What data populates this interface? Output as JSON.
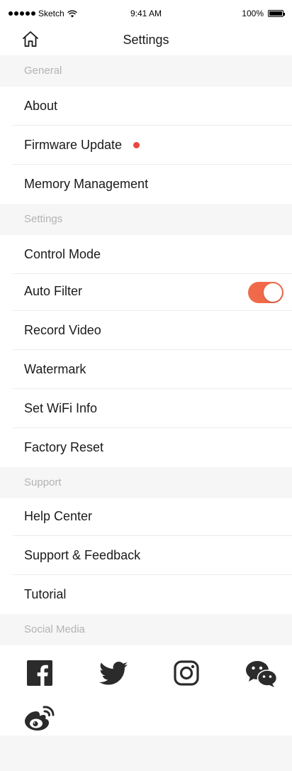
{
  "status_bar": {
    "carrier": "Sketch",
    "time": "9:41 AM",
    "battery": "100%"
  },
  "nav": {
    "title": "Settings",
    "home_icon": "home-icon"
  },
  "sections": {
    "general": {
      "header": "General",
      "items": [
        "About",
        "Firmware Update",
        "Memory Management"
      ]
    },
    "settings": {
      "header": "Settings",
      "items": [
        "Control Mode",
        "Auto Filter",
        "Record Video",
        "Watermark",
        "Set WiFi Info",
        "Factory Reset"
      ]
    },
    "support": {
      "header": "Support",
      "items": [
        "Help Center",
        "Support & Feedback",
        "Tutorial"
      ]
    },
    "social": {
      "header": "Social Media",
      "icons": [
        "facebook-icon",
        "twitter-icon",
        "instagram-icon",
        "wechat-icon",
        "weibo-icon"
      ]
    }
  },
  "auto_filter_enabled": true,
  "firmware_update_badge": true,
  "colors": {
    "accent": "#f06a4a",
    "badge": "#e8483f",
    "section_bg": "#f6f6f6",
    "section_text": "#b3b3b3"
  }
}
